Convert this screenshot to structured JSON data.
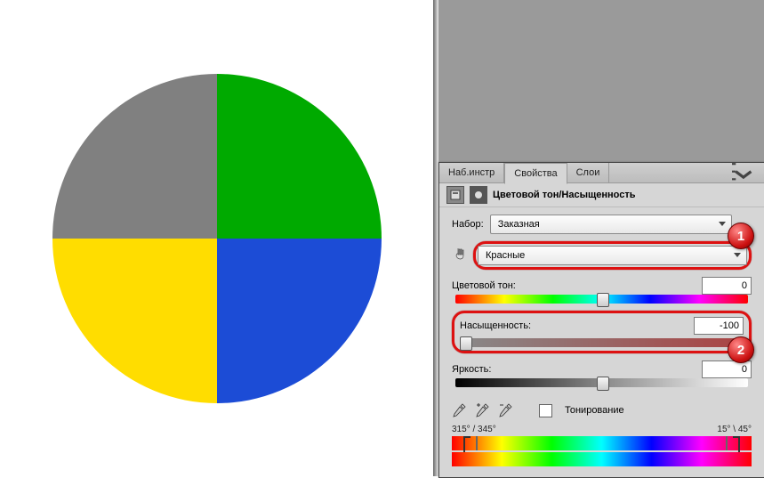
{
  "tabs": {
    "tools": "Наб.инстр",
    "properties": "Свойства",
    "layers": "Слои"
  },
  "header": {
    "title": "Цветовой тон/Насыщенность"
  },
  "preset": {
    "label": "Набор:",
    "value": "Заказная"
  },
  "color_range": {
    "value": "Красные"
  },
  "sliders": {
    "hue": {
      "label": "Цветовой тон:",
      "value": "0"
    },
    "saturation": {
      "label": "Насыщенность:",
      "value": "-100"
    },
    "lightness": {
      "label": "Яркость:",
      "value": "0"
    }
  },
  "colorize": {
    "label": "Тонирование"
  },
  "range": {
    "left": "315° / 345°",
    "right": "15° \\ 45°"
  },
  "badges": {
    "one": "1",
    "two": "2"
  },
  "colors": {
    "gray": "#808080",
    "green": "#00aa00",
    "yellow": "#ffdd00",
    "blue": "#1c4cd6",
    "highlight": "#dd1111"
  },
  "chart_data": {
    "type": "pie",
    "title": "",
    "categories": [
      "top-left",
      "top-right",
      "bottom-left",
      "bottom-right"
    ],
    "values": [
      25,
      25,
      25,
      25
    ],
    "colors": [
      "#808080",
      "#00aa00",
      "#ffdd00",
      "#1c4cd6"
    ]
  }
}
